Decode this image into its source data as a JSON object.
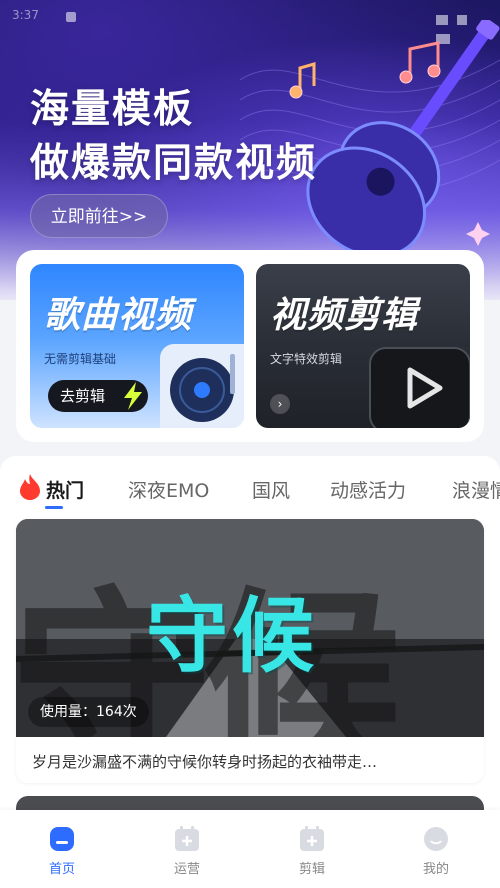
{
  "status_bar": {
    "time": "3:37"
  },
  "hero": {
    "title_line1": "海量模板",
    "title_line2": "做爆款同款视频",
    "cta_label": "立即前往>>"
  },
  "features": [
    {
      "title": "歌曲视频",
      "subtitle": "无需剪辑基础",
      "button": "去剪辑"
    },
    {
      "title": "视频剪辑",
      "subtitle": "文字特效剪辑"
    }
  ],
  "tabs": [
    {
      "label": "热门",
      "active": true
    },
    {
      "label": "深夜EMO"
    },
    {
      "label": "国风"
    },
    {
      "label": "动感活力"
    },
    {
      "label": "浪漫情"
    }
  ],
  "template_card": {
    "title": "守候",
    "ghost_text": "守候",
    "usage": "使用量：164次",
    "description": "岁月是沙漏盛不满的守候你转身时扬起的衣袖带走…"
  },
  "bottom_nav": [
    {
      "label": "首页",
      "icon": "home-icon",
      "active": true
    },
    {
      "label": "运营",
      "icon": "add-box-icon"
    },
    {
      "label": "剪辑",
      "icon": "edit-box-icon"
    },
    {
      "label": "我的",
      "icon": "profile-icon"
    }
  ],
  "colors": {
    "accent": "#2d6cff",
    "title_cyan": "#39e6e6"
  }
}
